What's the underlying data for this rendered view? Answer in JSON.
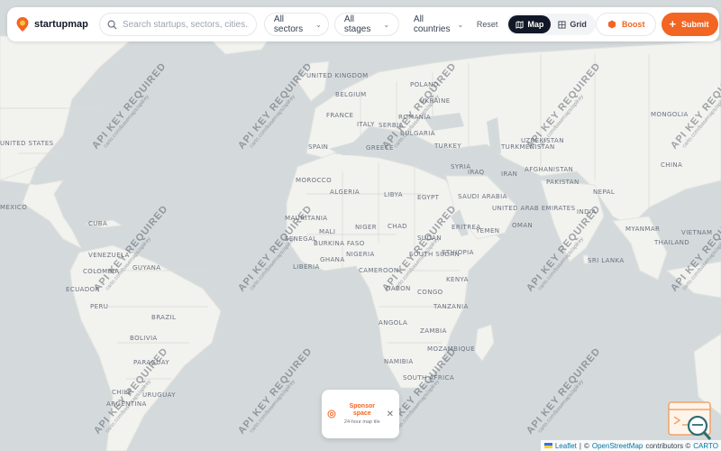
{
  "app": {
    "name": "startupmap"
  },
  "search": {
    "placeholder": "Search startups, sectors, cities..."
  },
  "filters": {
    "sectors": "All sectors",
    "stages": "All stages",
    "countries": "All countries",
    "reset": "Reset"
  },
  "view_toggle": {
    "map": "Map",
    "grid": "Grid",
    "active": "Map"
  },
  "actions": {
    "boost": "Boost",
    "submit": "Submit"
  },
  "sponsor": {
    "title": "Sponsor space",
    "subtitle": "24-hour map tile"
  },
  "watermark": {
    "title": "API KEY REQUIRED",
    "subtitle": "carto.com/basemaps/apikey"
  },
  "attribution": {
    "leaflet": "Leaflet",
    "sep": "|",
    "copy1": "©",
    "osm": "OpenStreetMap",
    "contributors": "contributors ©",
    "carto": "CARTO"
  },
  "countries": [
    "UNITED KINGDOM",
    "BELGIUM",
    "POLAND",
    "UKRAINE",
    "FRANCE",
    "ROMANIA",
    "SERBIA",
    "ITALY",
    "BULGARIA",
    "SPAIN",
    "GREECE",
    "TURKEY",
    "UZBEKISTAN",
    "TURKMENISTAN",
    "MONGOLIA",
    "CHINA",
    "SYRIA",
    "IRAQ",
    "IRAN",
    "AFGHANISTAN",
    "PAKISTAN",
    "NEPAL",
    "INDIA",
    "MYANMAR",
    "THAILAND",
    "VIETNAM",
    "SRI LANKA",
    "MOROCCO",
    "ALGERIA",
    "LIBYA",
    "EGYPT",
    "SAUDI ARABIA",
    "UNITED ARAB EMIRATES",
    "OMAN",
    "YEMEN",
    "MAURITANIA",
    "MALI",
    "NIGER",
    "CHAD",
    "SUDAN",
    "ERITREA",
    "SENEGAL",
    "BURKINA FASO",
    "NIGERIA",
    "SOUTH SUDAN",
    "ETHIOPIA",
    "GHANA",
    "LIBERIA",
    "CAMEROON",
    "KENYA",
    "GABON",
    "CONGO",
    "TANZANIA",
    "ANGOLA",
    "ZAMBIA",
    "MOZAMBIQUE",
    "NAMIBIA",
    "SOUTH AFRICA",
    "UNITED STATES",
    "MEXICO",
    "CUBA",
    "VENEZUELA",
    "COLOMBIA",
    "GUYANA",
    "ECUADOR",
    "PERU",
    "BRAZIL",
    "BOLIVIA",
    "PARAGUAY",
    "CHILE",
    "ARGENTINA",
    "URUGUAY"
  ],
  "colors": {
    "accent": "#f26522",
    "water": "#d4dadc",
    "land": "#f2f2f0"
  }
}
